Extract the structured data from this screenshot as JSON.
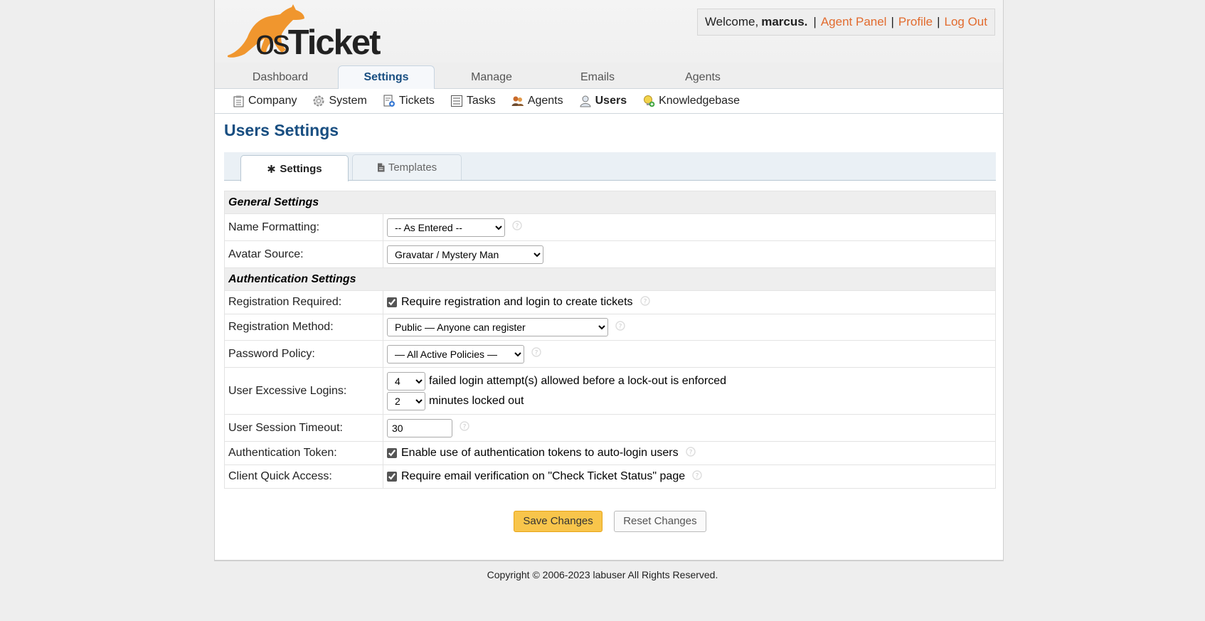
{
  "header": {
    "logo_text_os": "os",
    "logo_text_ticket": "Ticket",
    "welcome_prefix": "Welcome,",
    "username": "marcus.",
    "links": [
      "Agent Panel",
      "Profile",
      "Log Out"
    ],
    "separator": "|"
  },
  "nav": {
    "tabs": [
      "Dashboard",
      "Settings",
      "Manage",
      "Emails",
      "Agents"
    ],
    "active": "Settings"
  },
  "subnav": {
    "items": [
      "Company",
      "System",
      "Tickets",
      "Tasks",
      "Agents",
      "Users",
      "Knowledgebase"
    ],
    "active": "Users"
  },
  "page": {
    "title": "Users Settings",
    "tabs": [
      "Settings",
      "Templates"
    ]
  },
  "form": {
    "general_section": "General Settings",
    "name_formatting_label": "Name Formatting:",
    "name_formatting_value": "-- As Entered --",
    "avatar_source_label": "Avatar Source:",
    "avatar_source_value": "Gravatar / Mystery Man",
    "auth_section": "Authentication Settings",
    "registration_required_label": "Registration Required:",
    "registration_required_text": "Require registration and login to create tickets",
    "registration_method_label": "Registration Method:",
    "registration_method_value": "Public — Anyone can register",
    "password_policy_label": "Password Policy:",
    "password_policy_value": "— All Active Policies —",
    "excessive_logins_label": "User Excessive Logins:",
    "attempts_value": "4",
    "attempts_text": "failed login attempt(s) allowed before a lock-out is enforced",
    "lockout_value": "2",
    "lockout_text": "minutes locked out",
    "session_timeout_label": "User Session Timeout:",
    "session_timeout_value": "30",
    "auth_token_label": "Authentication Token:",
    "auth_token_text": "Enable use of authentication tokens to auto-login users",
    "quick_access_label": "Client Quick Access:",
    "quick_access_text": "Require email verification on \"Check Ticket Status\" page"
  },
  "buttons": {
    "save": "Save Changes",
    "reset": "Reset Changes"
  },
  "footer": {
    "copyright": "Copyright © 2006-2023 labuser All Rights Reserved."
  },
  "colors": {
    "accent_link": "#e26b2e",
    "title_blue": "#184e81",
    "save_button": "#f8c54b",
    "logo_orange": "#f0962e"
  }
}
